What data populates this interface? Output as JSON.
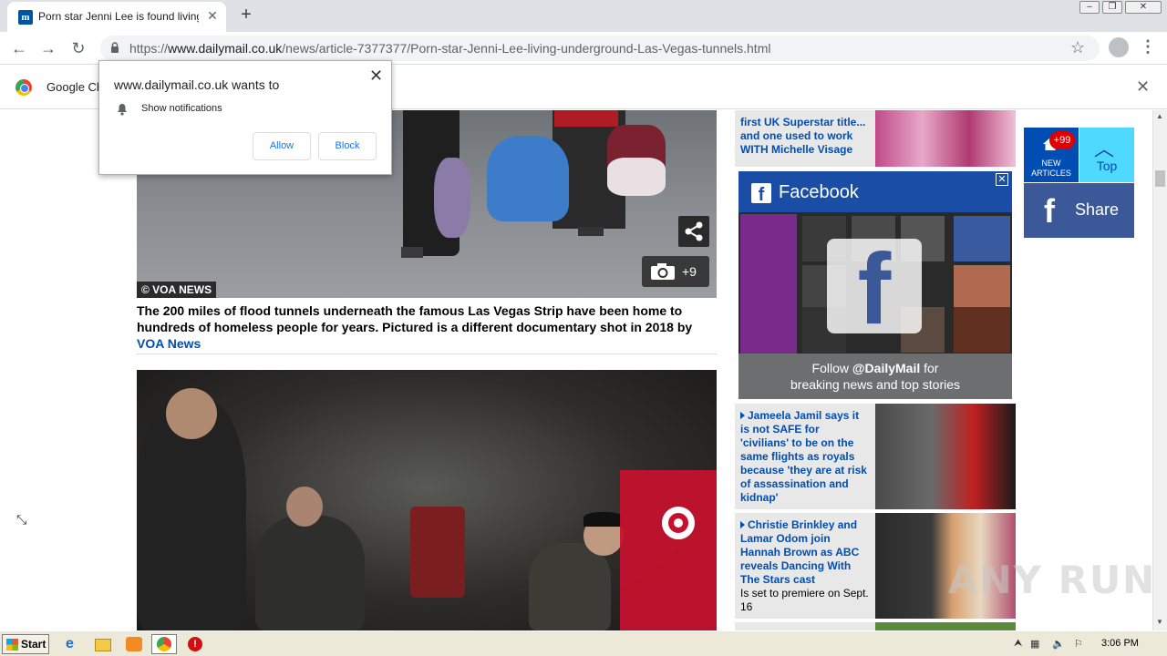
{
  "browser": {
    "tab_title": "Porn star Jenni Lee is found living in",
    "tab_favicon": "m",
    "url_prefix": "https://",
    "url_host": "www.dailymail.co.uk",
    "url_path": "/news/article-7377377/Porn-star-Jenni-Lee-living-underground-Las-Vegas-tunnels.html",
    "infobar_text": "Google Ch"
  },
  "notification_popup": {
    "title": "www.dailymail.co.uk wants to",
    "permission": "Show notifications",
    "allow_label": "Allow",
    "block_label": "Block"
  },
  "article": {
    "photo1_credit": "© VOA NEWS",
    "gallery_count": "+9",
    "caption_text": "The 200 miles of flood tunnels underneath the famous Las Vegas Strip have been home to hundreds of homeless people for years. Pictured is a different documentary shot in 2018 by ",
    "caption_link": "VOA News"
  },
  "sidebar": {
    "puff1_text": "first UK Superstar title... and one used to work WITH Michelle Visage",
    "facebook": {
      "title": "Facebook",
      "follow_prefix": "Follow ",
      "handle": "@DailyMail",
      "follow_suffix": " for",
      "tagline": "breaking news and top stories"
    },
    "puff2_text": "Jameela Jamil says it is not SAFE for 'civilians' to be on the same flights as royals because 'they are at risk of assassination and kidnap'",
    "puff3_text": "Christie Brinkley and Lamar Odom join Hannah Brown as ABC reveals Dancing With The Stars cast",
    "puff3_sub": "Is set to premiere on Sept. 16"
  },
  "floating": {
    "badge": "+99",
    "new_articles": "NEW ARTICLES",
    "top": "Top",
    "share": "Share"
  },
  "watermark": "ANY RUN",
  "taskbar": {
    "start": "Start",
    "clock": "3:06 PM"
  },
  "colors": {
    "dm_blue": "#004db3",
    "facebook_blue": "#3b5998",
    "top_button": "#4fd9ff",
    "badge_red": "#e10000"
  }
}
